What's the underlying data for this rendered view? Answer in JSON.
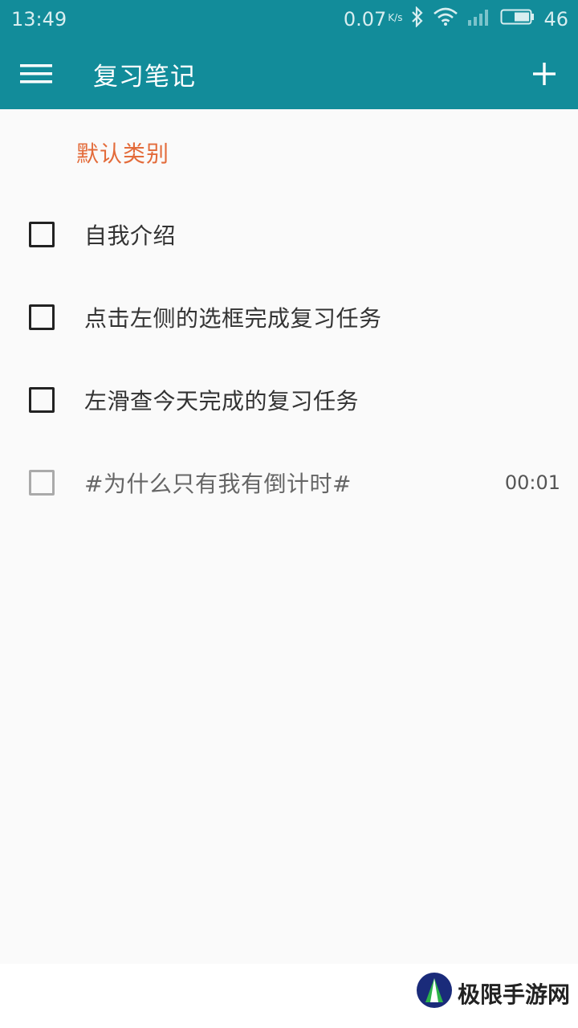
{
  "status_bar": {
    "time": "13:49",
    "speed": "0.07",
    "speed_unit": "K/s",
    "battery": "46",
    "icons": [
      "bluetooth-icon",
      "wifi-icon",
      "signal-icon",
      "battery-icon"
    ]
  },
  "app_bar": {
    "title": "复习笔记",
    "menu_icon": "hamburger-menu-icon",
    "add_icon": "plus-icon",
    "color": "#128c9a"
  },
  "category": {
    "label": "默认类别",
    "color": "#e36b3a"
  },
  "tasks": [
    {
      "text": "自我介绍",
      "timer": ""
    },
    {
      "text": "点击左侧的选框完成复习任务",
      "timer": ""
    },
    {
      "text": "左滑查今天完成的复习任务",
      "timer": ""
    },
    {
      "text": "#为什么只有我有倒计时#",
      "timer": "00:01"
    }
  ],
  "watermark": {
    "text": "极限手游网"
  }
}
